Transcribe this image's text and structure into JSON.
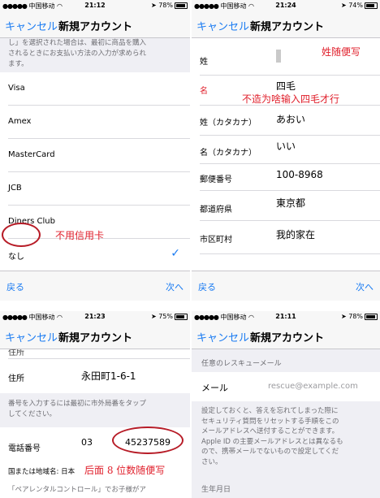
{
  "panel1": {
    "status": {
      "carrier": "中国移动",
      "time": "21:12",
      "battery": "78%",
      "battery_level": 0.78
    },
    "nav": {
      "cancel": "キャンセル",
      "title": "新規アカウント"
    },
    "note_line1": "し」を選択された場合は、最初に商品を購入",
    "note_line2": "されるときにお支払い方法の入力が求められ",
    "note_line3": "ます。",
    "options": [
      "Visa",
      "Amex",
      "MasterCard",
      "JCB",
      "Diners Club",
      "なし"
    ],
    "selected_mark": "✓",
    "annotation": "不用信用卡",
    "toolbar": {
      "back": "戻る",
      "next": "次へ"
    }
  },
  "panel2": {
    "status": {
      "carrier": "中国移动",
      "time": "21:24",
      "battery": "74%",
      "battery_level": 0.74
    },
    "nav": {
      "cancel": "キャンセル",
      "title": "新規アカウント"
    },
    "fields": [
      {
        "label": "姓",
        "value": ""
      },
      {
        "label": "名",
        "value": "四毛"
      },
      {
        "label": "姓（カタカナ）",
        "value": "あおい"
      },
      {
        "label": "名（カタカナ）",
        "value": "いい"
      },
      {
        "label": "郵便番号",
        "value": "100-8968"
      },
      {
        "label": "都道府県",
        "value": "東京都"
      },
      {
        "label": "市区町村",
        "value": "我的家在"
      }
    ],
    "annotation1": "姓随便写",
    "annotation2": "不造为啥输入四毛才行",
    "toolbar": {
      "back": "戻る",
      "next": "次へ"
    },
    "accent": "#e0202c"
  },
  "panel3": {
    "status": {
      "carrier": "中国移动",
      "time": "21:23",
      "battery": "75%",
      "battery_level": 0.75
    },
    "nav": {
      "cancel": "キャンセル",
      "title": "新規アカウント"
    },
    "top_partial_label": "住所",
    "address_label": "住所",
    "address_value": "永田町1-6-1",
    "phone_note_line1": "番号を入力するには最初に市外局番をタップ",
    "phone_note_line2": "してください。",
    "phone_label": "電話番号",
    "phone_area": "03",
    "phone_number": "45237589",
    "country": "国または地域名: 日本",
    "annotation": "后面 8 位数随便写",
    "bottom_text": "「ペアレンタルコントロール」でお子様がア"
  },
  "panel4": {
    "status": {
      "carrier": "中国移动",
      "time": "21:11",
      "battery": "78%",
      "battery_level": 0.78
    },
    "nav": {
      "cancel": "キャンセル",
      "title": "新規アカウント"
    },
    "section": "任意のレスキューメール",
    "email_label": "メール",
    "email_placeholder": "rescue@example.com",
    "desc_line1": "設定しておくと、答えを忘れてしまった際に",
    "desc_line2": "セキュリティ質問をリセットする手順をこの",
    "desc_line3": "メールアドレスへ送付することができます。",
    "desc_line4": "Apple ID の主要メールアドレスとは異なるも",
    "desc_line5": "ので、携帯メールでないもので設定してくだ",
    "desc_line6": "さい。",
    "birth_section": "生年月日"
  },
  "colors": {
    "ios_blue": "#1a7bf2",
    "annotation_red": "#e0202c",
    "ring_red": "#b71c27"
  }
}
